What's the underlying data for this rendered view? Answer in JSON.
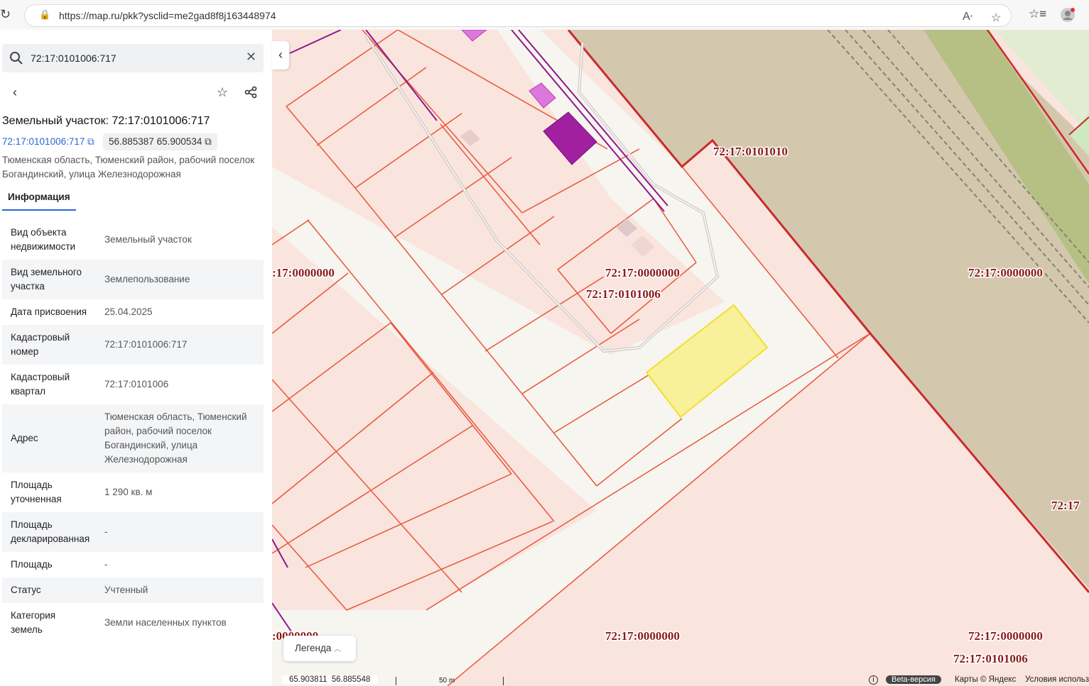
{
  "browser": {
    "url": "https://map.ru/pkk?ysclid=me2gad8f8j163448974"
  },
  "search": {
    "value": "72:17:0101006:717"
  },
  "object": {
    "title": "Земельный участок: 72:17:0101006:717",
    "cad_link": "72:17:0101006:717",
    "coords": "56.885387 65.900534",
    "address_line1": "Тюменская область, Тюменский район, рабочий поселок",
    "address_line2": "Богандинский, улица Железнодорожная"
  },
  "tabs": {
    "info": "Информация"
  },
  "info_rows": [
    {
      "k1": "Вид объекта",
      "k2": "недвижимости",
      "v1": "Земельный участок"
    },
    {
      "k1": "Вид земельного",
      "k2": "участка",
      "v1": "Землепользование"
    },
    {
      "k1": "Дата присвоения",
      "v1": "25.04.2025"
    },
    {
      "k1": "Кадастровый",
      "k2": "номер",
      "v1": "72:17:0101006:717"
    },
    {
      "k1": "Кадастровый",
      "k2": "квартал",
      "v1": "72:17:0101006"
    },
    {
      "k1": "Адрес",
      "v1": "Тюменская область, Тюменский",
      "v2": "район, рабочий поселок",
      "v3": "Богандинский, улица",
      "v4": "Железнодорожная"
    },
    {
      "k1": "Площадь",
      "k2": "уточненная",
      "v1": "1 290 кв. м"
    },
    {
      "k1": "Площадь",
      "k2": "декларированная",
      "v1": "-"
    },
    {
      "k1": "Площадь",
      "v1": "-"
    },
    {
      "k1": "Статус",
      "v1": "Учтенный"
    },
    {
      "k1": "Категория",
      "k2": "земель",
      "v1": "Земли населенных пунктов"
    }
  ],
  "map": {
    "labels": {
      "l1": "72:17:0101010",
      "l2": ":17:0000000",
      "l3": "72:17:0000000",
      "l4": "72:17:0101006",
      "l5": "72:17:0000000",
      "l6": "72:17",
      "l7": ":0000000",
      "l8": "72:17:0000000",
      "l9": "72:17:0000000",
      "l10": "72:17:0101006"
    },
    "legend": "Легенда",
    "coord_readout": "65.903811  56.885548",
    "scale": "50 m",
    "beta": "Beta-версия",
    "yandex": "Карты © Яндекс",
    "terms": "Условия использ"
  },
  "colors": {
    "parcel_fill": "#f9e4de",
    "parcel_stroke": "#e8573a",
    "quarter_stroke": "#cc2a2a",
    "selected_fill": "#f9f09a",
    "selected_stroke": "#f0e030",
    "road": "#f7f5f0",
    "railway_zone": "#d3c8ad",
    "green": "#b6c085",
    "label_text": "#8b1a1a",
    "link": "#2a66d6"
  }
}
